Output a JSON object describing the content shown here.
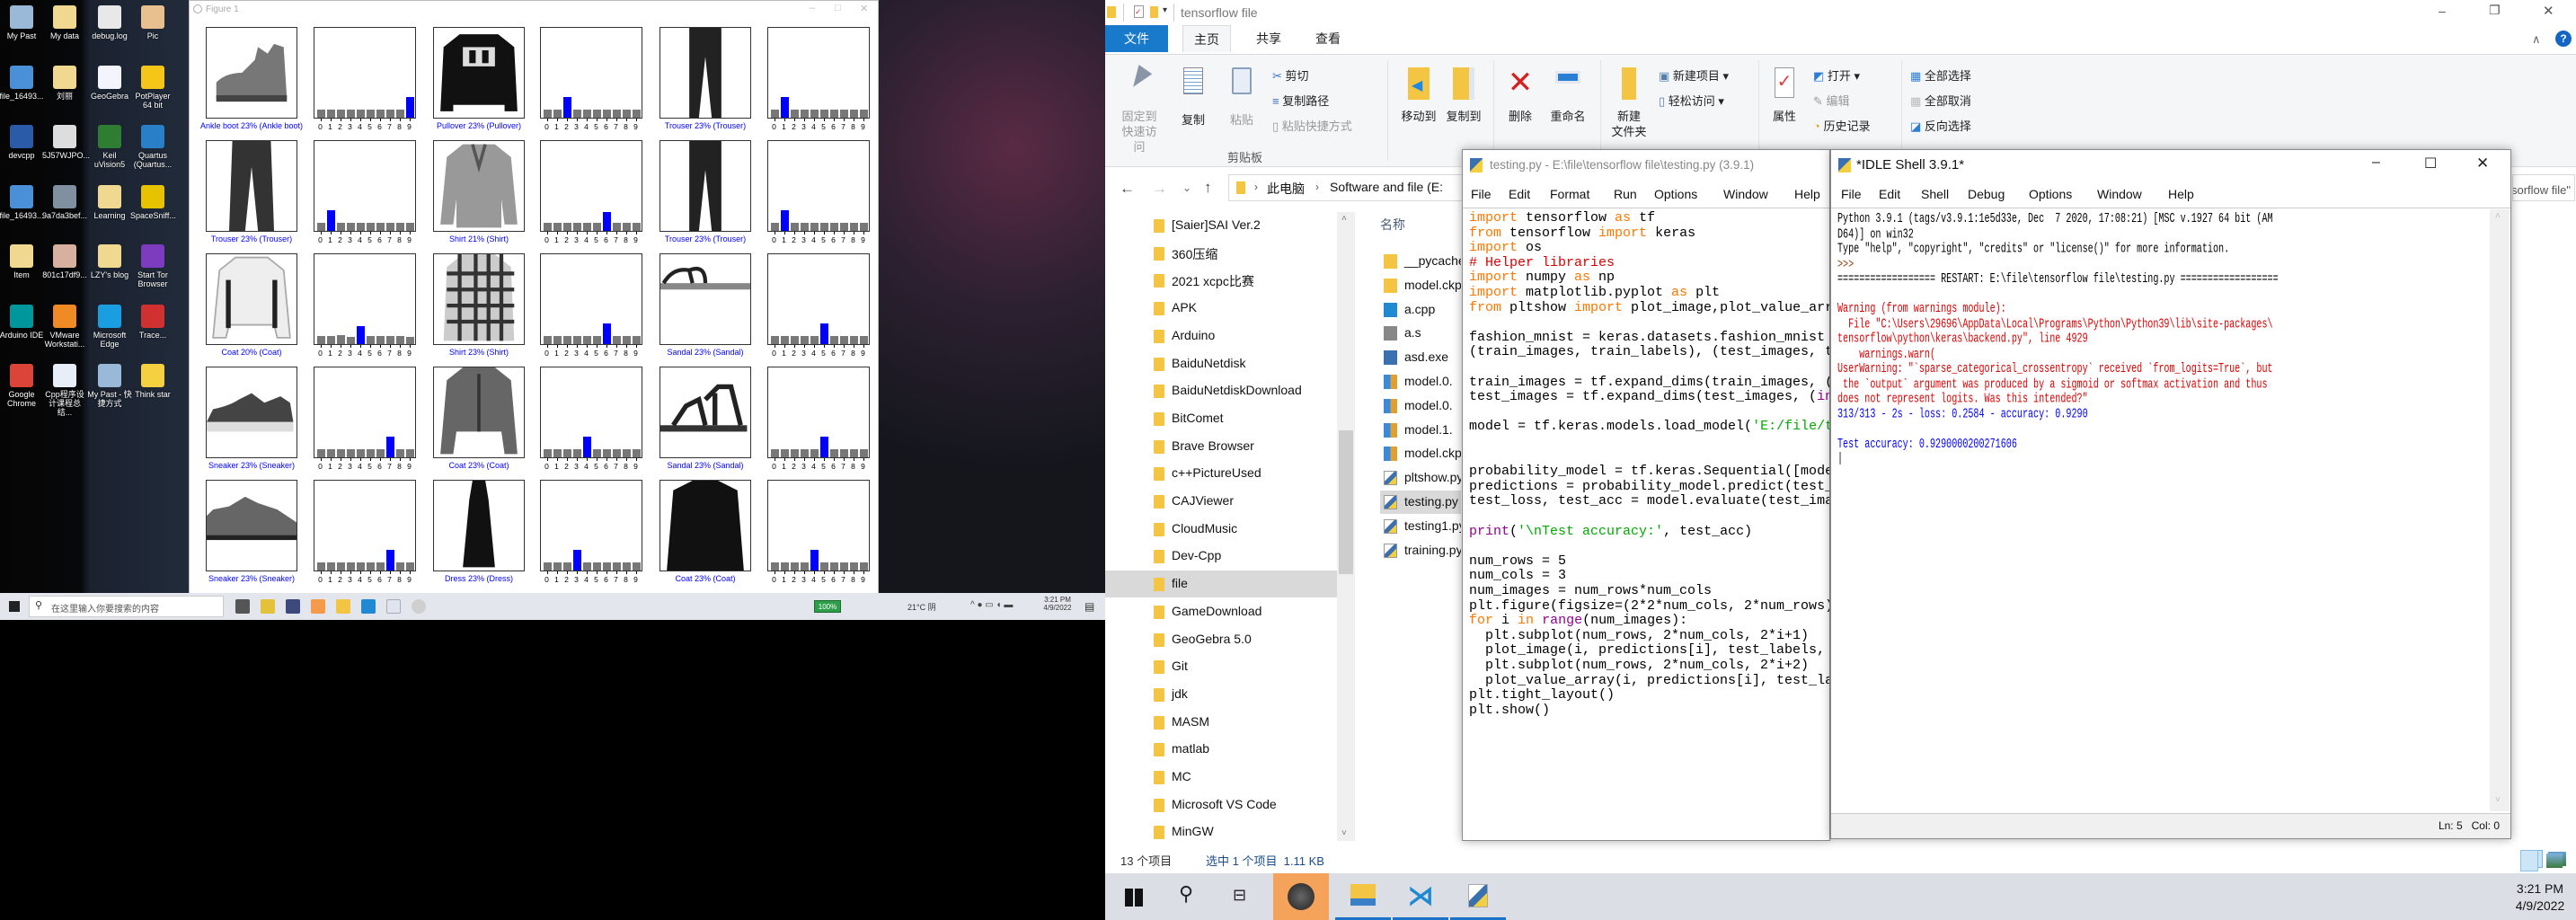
{
  "desktop": {
    "icons": [
      {
        "label": "My Past",
        "color": "#9ab8d8"
      },
      {
        "label": "My data",
        "color": "#f0d890"
      },
      {
        "label": "debug.log",
        "color": "#e8e8e8"
      },
      {
        "label": "Pic",
        "color": "#e8c090"
      },
      {
        "label": "file_16493...",
        "color": "#4a90d9"
      },
      {
        "label": "刘丽",
        "color": "#f0d890"
      },
      {
        "label": "GeoGebra",
        "color": "#f4f4ff"
      },
      {
        "label": "PotPlayer 64 bit",
        "color": "#f5c518"
      },
      {
        "label": "devcpp",
        "color": "#2a5aa8"
      },
      {
        "label": "5J57WJPO...",
        "color": "#dddddd"
      },
      {
        "label": "Keil uVision5",
        "color": "#2e7d32"
      },
      {
        "label": "Quartus (Quartus...",
        "color": "#2a80c8"
      },
      {
        "label": "file_16493...",
        "color": "#4a90d9"
      },
      {
        "label": "9a7da3bef...",
        "color": "#8090a0"
      },
      {
        "label": "Learning",
        "color": "#f0d890"
      },
      {
        "label": "SpaceSniff...",
        "color": "#e6c200"
      },
      {
        "label": "Item",
        "color": "#f0d890"
      },
      {
        "label": "801c17df9...",
        "color": "#d8b0a0"
      },
      {
        "label": "LZY's blog",
        "color": "#f0d890"
      },
      {
        "label": "Start Tor Browser",
        "color": "#7d3cbf"
      },
      {
        "label": "Arduino IDE",
        "color": "#00979c"
      },
      {
        "label": "VMware Workstati...",
        "color": "#f08a24"
      },
      {
        "label": "Microsoft Edge",
        "color": "#1b9de2"
      },
      {
        "label": "Trace...",
        "color": "#d03030"
      },
      {
        "label": "Google Chrome",
        "color": "#db4437"
      },
      {
        "label": "Cpp程序设计课程总结...",
        "color": "#e8eef8"
      },
      {
        "label": "My Past - 快捷方式",
        "color": "#9ab8d8"
      },
      {
        "label": "Think star",
        "color": "#f5d040"
      }
    ]
  },
  "figure": {
    "title": "Figure 1",
    "tick_labels": [
      "0",
      "1",
      "2",
      "3",
      "4",
      "5",
      "6",
      "7",
      "8",
      "9"
    ],
    "ylim": [
      0,
      1
    ],
    "colors": {
      "predicted_correct": "#0000ff",
      "other": "#777777"
    },
    "predictions": [
      {
        "caption": "Ankle boot 23% (Ankle boot)",
        "kind": "boot",
        "pred": 9,
        "probs": [
          0.0853,
          0.0853,
          0.0853,
          0.0853,
          0.0853,
          0.0853,
          0.0853,
          0.0853,
          0.0853,
          0.232
        ]
      },
      {
        "caption": "Pullover 23% (Pullover)",
        "kind": "pullover",
        "pred": 2,
        "probs": [
          0.0853,
          0.0853,
          0.232,
          0.0853,
          0.0853,
          0.0853,
          0.0853,
          0.0853,
          0.0853,
          0.0853
        ]
      },
      {
        "caption": "Trouser 23% (Trouser)",
        "kind": "trouser",
        "pred": 1,
        "probs": [
          0.0853,
          0.232,
          0.0853,
          0.0853,
          0.0853,
          0.0853,
          0.0853,
          0.0853,
          0.0853,
          0.0853
        ]
      },
      {
        "caption": "Trouser 23% (Trouser)",
        "kind": "trouser2",
        "pred": 1,
        "probs": [
          0.0853,
          0.232,
          0.0853,
          0.0853,
          0.0853,
          0.0853,
          0.0853,
          0.0853,
          0.0853,
          0.0853
        ]
      },
      {
        "caption": "Shirt 21% (Shirt)",
        "kind": "shirt",
        "pred": 6,
        "probs": [
          0.095,
          0.086,
          0.086,
          0.086,
          0.086,
          0.086,
          0.21,
          0.086,
          0.086,
          0.086
        ]
      },
      {
        "caption": "Trouser 23% (Trouser)",
        "kind": "trouser",
        "pred": 1,
        "probs": [
          0.0853,
          0.232,
          0.0853,
          0.0853,
          0.0853,
          0.0853,
          0.0853,
          0.0853,
          0.0853,
          0.0853
        ]
      },
      {
        "caption": "Coat 20% (Coat)",
        "kind": "coat",
        "pred": 4,
        "probs": [
          0.09,
          0.09,
          0.1,
          0.085,
          0.2,
          0.09,
          0.09,
          0.09,
          0.09,
          0.085
        ]
      },
      {
        "caption": "Shirt 23% (Shirt)",
        "kind": "plaid",
        "pred": 6,
        "probs": [
          0.0853,
          0.0853,
          0.0853,
          0.0853,
          0.0853,
          0.0853,
          0.232,
          0.0853,
          0.0853,
          0.0853
        ]
      },
      {
        "caption": "Sandal 23% (Sandal)",
        "kind": "sandal",
        "pred": 5,
        "probs": [
          0.0853,
          0.0853,
          0.0853,
          0.0853,
          0.0853,
          0.232,
          0.0853,
          0.0853,
          0.0853,
          0.0853
        ]
      },
      {
        "caption": "Sneaker 23% (Sneaker)",
        "kind": "sneaker",
        "pred": 7,
        "probs": [
          0.0853,
          0.0853,
          0.0853,
          0.0853,
          0.0853,
          0.0853,
          0.0853,
          0.232,
          0.0853,
          0.0853
        ]
      },
      {
        "caption": "Coat 23% (Coat)",
        "kind": "jacket",
        "pred": 4,
        "probs": [
          0.0853,
          0.0853,
          0.0853,
          0.0853,
          0.232,
          0.0853,
          0.0853,
          0.0853,
          0.0853,
          0.0853
        ]
      },
      {
        "caption": "Sandal 23% (Sandal)",
        "kind": "sandal2",
        "pred": 5,
        "probs": [
          0.0853,
          0.0853,
          0.0853,
          0.0853,
          0.0853,
          0.232,
          0.0853,
          0.0853,
          0.0853,
          0.0853
        ]
      },
      {
        "caption": "Sneaker 23% (Sneaker)",
        "kind": "sneaker2",
        "pred": 7,
        "probs": [
          0.0853,
          0.0853,
          0.0853,
          0.0853,
          0.0853,
          0.0853,
          0.09,
          0.232,
          0.0853,
          0.0853
        ]
      },
      {
        "caption": "Dress 23% (Dress)",
        "kind": "dress",
        "pred": 3,
        "probs": [
          0.0853,
          0.0853,
          0.0853,
          0.232,
          0.0853,
          0.0853,
          0.0853,
          0.0853,
          0.0853,
          0.0853
        ]
      },
      {
        "caption": "Coat 23% (Coat)",
        "kind": "coat2",
        "pred": 4,
        "probs": [
          0.0853,
          0.0853,
          0.0853,
          0.0853,
          0.232,
          0.0853,
          0.0853,
          0.0853,
          0.0853,
          0.0853
        ]
      }
    ]
  },
  "left_taskbar": {
    "search_placeholder": "在这里输入你要搜索的内容",
    "battery": "100%",
    "weather": "21°C 阴",
    "time": "3:21 PM",
    "date": "4/9/2022"
  },
  "explorer": {
    "title": "tensorflow file",
    "tabs": {
      "file": "文件",
      "home": "主页",
      "share": "共享",
      "view": "查看"
    },
    "accent": "#1979ca",
    "ribbon": {
      "pin": "固定到快速访问",
      "copy": "复制",
      "paste": "粘贴",
      "cut": "剪切",
      "copy_path": "复制路径",
      "paste_shortcut": "粘贴快捷方式",
      "clipboard_group": "剪贴板",
      "move_to": "移动到",
      "copy_to": "复制到",
      "delete": "删除",
      "rename": "重命名",
      "new_folder_1": "新建",
      "new_folder_2": "文件夹",
      "new_item": "新建项目 ▾",
      "easy_access": "轻松访问 ▾",
      "properties": "属性",
      "open": "打开 ▾",
      "edit": "编辑",
      "history": "历史记录",
      "select_all": "全部选择",
      "select_none": "全部取消",
      "invert_selection": "反向选择"
    },
    "breadcrumb": [
      "此电脑",
      "Software and file (E:"
    ],
    "search_value": "搜索\"tensorflow file\"",
    "nav_items": [
      "[Saier]SAI Ver.2",
      "360压缩",
      "2021 xcpc比赛",
      "APK",
      "Arduino",
      "BaiduNetdisk",
      "BaiduNetdiskDownload",
      "BitComet",
      "Brave Browser",
      "c++PictureUsed",
      "CAJViewer",
      "CloudMusic",
      "Dev-Cpp",
      "file",
      "GameDownload",
      "GeoGebra 5.0",
      "Git",
      "jdk",
      "MASM",
      "matlab",
      "MC",
      "Microsoft VS Code",
      "MinGW"
    ],
    "nav_selected": "file",
    "column_name": "名称",
    "files": [
      {
        "name": "__pycache__",
        "type": "folder"
      },
      {
        "name": "model.ckpt",
        "type": "folder"
      },
      {
        "name": "a.cpp",
        "type": "vscode"
      },
      {
        "name": "a.s",
        "type": "asm"
      },
      {
        "name": "asd.exe",
        "type": "exe"
      },
      {
        "name": "model.0.",
        "type": "archive"
      },
      {
        "name": "model.0.",
        "type": "archive"
      },
      {
        "name": "model.1.",
        "type": "archive"
      },
      {
        "name": "model.ckpt",
        "type": "archive"
      },
      {
        "name": "pltshow.py",
        "type": "python"
      },
      {
        "name": "testing.py",
        "type": "python",
        "selected": true
      },
      {
        "name": "testing1.py",
        "type": "python"
      },
      {
        "name": "training.py",
        "type": "python"
      }
    ],
    "status_count": "13 个项目",
    "status_selected": "选中 1 个项目  1.11 KB"
  },
  "editor": {
    "title": "testing.py - E:\\file\\tensorflow file\\testing.py (3.9.1)",
    "menu": [
      "File",
      "Edit",
      "Format",
      "Run",
      "Options",
      "Window",
      "Help"
    ],
    "lines": [
      "import tensorflow as tf",
      "from tensorflow import keras",
      "import os",
      "# Helper libraries",
      "import numpy as np",
      "import matplotlib.pyplot as plt",
      "from pltshow import plot_image,plot_value_arr",
      "",
      "fashion_mnist = keras.datasets.fashion_mnist",
      "(train_images, train_labels), (test_images, t",
      "",
      "train_images = tf.expand_dims(train_images, (i",
      "test_images = tf.expand_dims(test_images, (int",
      "",
      "model = tf.keras.models.load_model('E:/file/t",
      "",
      "",
      "probability_model = tf.keras.Sequential([mode",
      "predictions = probability_model.predict(test_",
      "test_loss, test_acc = model.evaluate(test_ima",
      "",
      "print('\\nTest accuracy:', test_acc)",
      "",
      "num_rows = 5",
      "num_cols = 3",
      "num_images = num_rows*num_cols",
      "plt.figure(figsize=(2*2*num_cols, 2*num_rows)",
      "for i in range(num_images):",
      "  plt.subplot(num_rows, 2*num_cols, 2*i+1)",
      "  plot_image(i, predictions[i], test_labels,",
      "  plt.subplot(num_rows, 2*num_cols, 2*i+2)",
      "  plot_value_array(i, predictions[i], test_la",
      "plt.tight_layout()",
      "plt.show()"
    ]
  },
  "shell": {
    "title": "*IDLE Shell 3.9.1*",
    "menu": [
      "File",
      "Edit",
      "Shell",
      "Debug",
      "Options",
      "Window",
      "Help"
    ],
    "lines": [
      {
        "text": "Python 3.9.1 (tags/v3.9.1:1e5d33e, Dec  7 2020, 17:08:21) [MSC v.1927 64 bit (AM",
        "kind": "normal"
      },
      {
        "text": "D64)] on win32",
        "kind": "normal"
      },
      {
        "text": "Type \"help\", \"copyright\", \"credits\" or \"license()\" for more information.",
        "kind": "normal"
      },
      {
        "text": ">>> ",
        "kind": "prompt"
      },
      {
        "text": "================== RESTART: E:\\file\\tensorflow file\\testing.py ==================",
        "kind": "normal"
      },
      {
        "text": "",
        "kind": "normal"
      },
      {
        "text": "Warning (from warnings module):",
        "kind": "stderr"
      },
      {
        "text": "  File \"C:\\Users\\29696\\AppData\\Local\\Programs\\Python\\Python39\\lib\\site-packages\\",
        "kind": "stderr"
      },
      {
        "text": "tensorflow\\python\\keras\\backend.py\", line 4929",
        "kind": "stderr"
      },
      {
        "text": "    warnings.warn(",
        "kind": "stderr"
      },
      {
        "text": "UserWarning: \"`sparse_categorical_crossentropy` received `from_logits=True`, but",
        "kind": "stderr"
      },
      {
        "text": " the `output` argument was produced by a sigmoid or softmax activation and thus",
        "kind": "stderr"
      },
      {
        "text": "does not represent logits. Was this intended?\"",
        "kind": "stderr"
      },
      {
        "text": "313/313 - 2s - loss: 0.2584 - accuracy: 0.9290",
        "kind": "stdout"
      },
      {
        "text": "",
        "kind": "normal"
      },
      {
        "text": "Test accuracy: 0.9290000200271606",
        "kind": "stdout"
      },
      {
        "text": "|",
        "kind": "normal"
      }
    ],
    "status": "Ln: 5   Col: 0"
  },
  "taskbar": {
    "time": "3:21 PM",
    "date": "4/9/2022"
  }
}
